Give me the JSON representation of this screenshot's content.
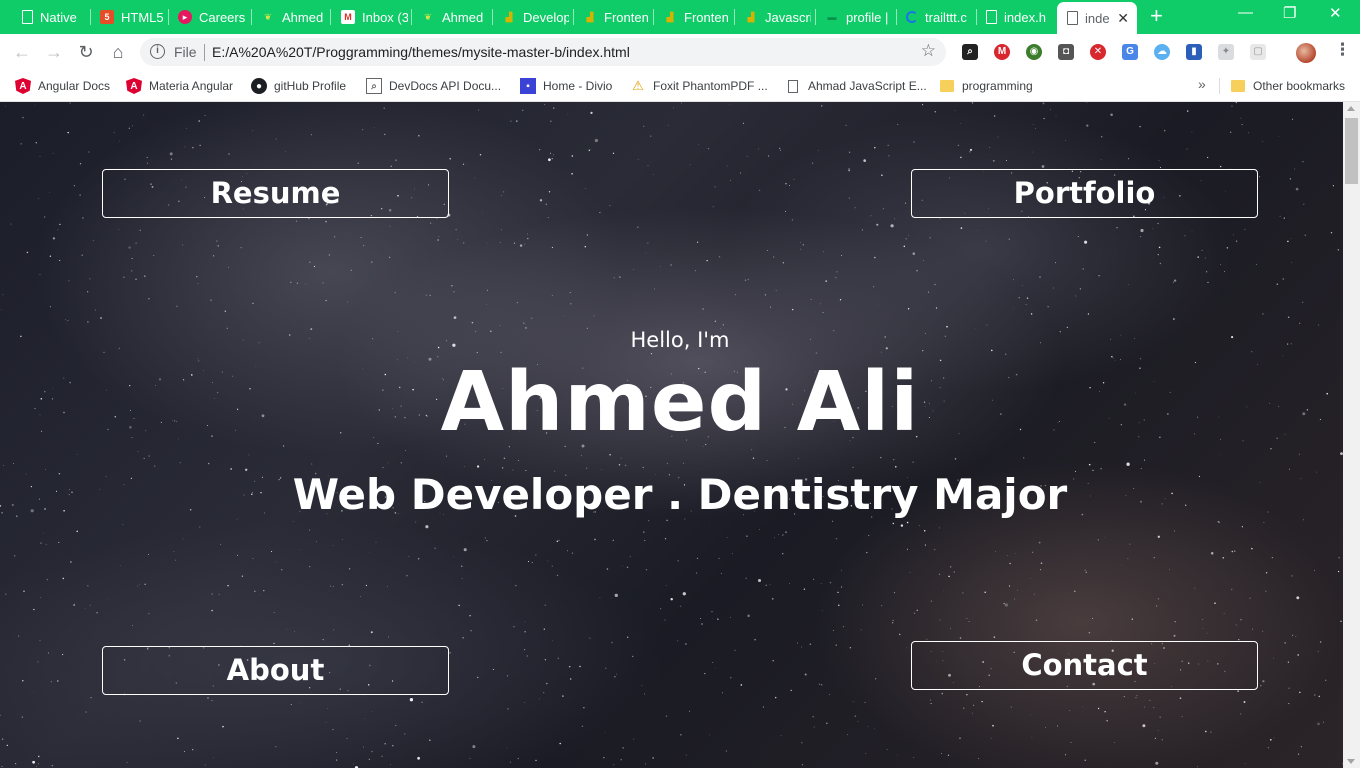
{
  "browser": {
    "tabs": [
      {
        "label": "Native",
        "favicon": "page-icon"
      },
      {
        "label": "HTML5",
        "favicon": "html5-icon"
      },
      {
        "label": "Careers",
        "favicon": "careers-icon"
      },
      {
        "label": "Ahmed",
        "favicon": "leaf-icon"
      },
      {
        "label": "Inbox (3",
        "favicon": "gmail-icon"
      },
      {
        "label": "Ahmed",
        "favicon": "leaf-icon"
      },
      {
        "label": "Develop",
        "favicon": "chart-icon"
      },
      {
        "label": "Fronten",
        "favicon": "chart-icon"
      },
      {
        "label": "Fronten",
        "favicon": "chart-icon"
      },
      {
        "label": "Javascri",
        "favicon": "chart-icon"
      },
      {
        "label": "profile |",
        "favicon": "dash-icon"
      },
      {
        "label": "trailttt.c",
        "favicon": "loading-icon"
      },
      {
        "label": "index.h",
        "favicon": "page-icon"
      }
    ],
    "active_tab": {
      "label": "inde",
      "favicon": "page-icon"
    },
    "tab_close": "✕",
    "new_tab": "+",
    "window_controls": {
      "minimize": "—",
      "maximize": "❐",
      "close": "✕"
    },
    "omnibox": {
      "scheme_label": "File",
      "url": "E:/A%20A%20T/Proggramming/themes/mysite-master-b/index.html"
    },
    "bookmarks": [
      {
        "label": "Angular Docs",
        "icon": "angular-icon"
      },
      {
        "label": "Materia Angular",
        "icon": "angular-icon"
      },
      {
        "label": "gitHub Profile",
        "icon": "github-icon"
      },
      {
        "label": "DevDocs API Docu...",
        "icon": "devdocs-icon"
      },
      {
        "label": "Home - Divio",
        "icon": "divio-icon"
      },
      {
        "label": "Foxit PhantomPDF ...",
        "icon": "foxit-icon"
      },
      {
        "label": "Ahmad JavaScript E...",
        "icon": "page-icon"
      },
      {
        "label": "programming",
        "icon": "folder-icon"
      }
    ],
    "bookmarks_more": "»",
    "other_bookmarks": "Other bookmarks"
  },
  "page": {
    "nav": {
      "resume": "Resume",
      "portfolio": "Portfolio",
      "about": "About",
      "contact": "Contact"
    },
    "hero": {
      "greeting": "Hello, I'm",
      "name": "Ahmed Ali",
      "role": "Web Developer . Dentistry Major"
    }
  },
  "colors": {
    "tabstrip": "#0fcc69",
    "page_text": "#ffffff"
  }
}
